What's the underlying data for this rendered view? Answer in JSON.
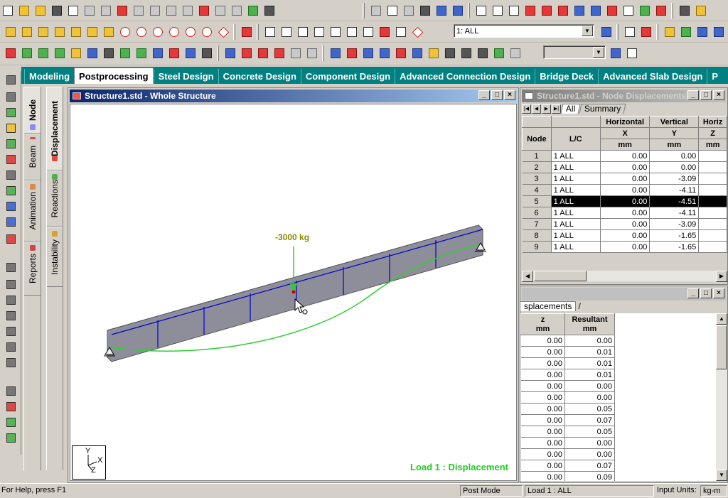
{
  "toolbars": {
    "row2_combo_value": "1: ALL",
    "row3_combo_value": ""
  },
  "page_tabs": [
    {
      "label": "Modeling",
      "active": false
    },
    {
      "label": "Postprocessing",
      "active": true
    },
    {
      "label": "Steel Design",
      "active": false
    },
    {
      "label": "Concrete Design",
      "active": false
    },
    {
      "label": "Component Design",
      "active": false
    },
    {
      "label": "Advanced Connection Design",
      "active": false
    },
    {
      "label": "Bridge Deck",
      "active": false
    },
    {
      "label": "Advanced Slab Design",
      "active": false
    },
    {
      "label": "P",
      "active": false
    }
  ],
  "side_tabs_outer": [
    "Node",
    "Beam",
    "Animation",
    "Reports"
  ],
  "side_tabs_inner": [
    "Displacement",
    "Reactions",
    "Instability"
  ],
  "view_window": {
    "title": "Structure1.std - Whole Structure",
    "load_label": "-3000 kg",
    "status_label": "Load 1 : Displacement",
    "axis_y": "Y",
    "axis_x": "X",
    "axis_z": "Z"
  },
  "displacements_window": {
    "title": "Structure1.std - Node Displacements:",
    "tabs": [
      "All",
      "Summary"
    ],
    "group_headers": [
      "Horizontal",
      "Vertical",
      "Horiz"
    ],
    "col_node": "Node",
    "col_lc": "L/C",
    "col_x": "X",
    "col_y": "Y",
    "col_z": "Z",
    "unit": "mm",
    "rows": [
      {
        "node": "1",
        "lc": "1 ALL",
        "x": "0.00",
        "y": "0.00"
      },
      {
        "node": "2",
        "lc": "1 ALL",
        "x": "0.00",
        "y": "0.00"
      },
      {
        "node": "3",
        "lc": "1 ALL",
        "x": "0.00",
        "y": "-3.09"
      },
      {
        "node": "4",
        "lc": "1 ALL",
        "x": "0.00",
        "y": "-4.11"
      },
      {
        "node": "5",
        "lc": "1 ALL",
        "x": "0.00",
        "y": "-4.51",
        "selected": true
      },
      {
        "node": "6",
        "lc": "1 ALL",
        "x": "0.00",
        "y": "-4.11"
      },
      {
        "node": "7",
        "lc": "1 ALL",
        "x": "0.00",
        "y": "-3.09"
      },
      {
        "node": "8",
        "lc": "1 ALL",
        "x": "0.00",
        "y": "-1.65"
      },
      {
        "node": "9",
        "lc": "1 ALL",
        "x": "0.00",
        "y": "-1.65"
      }
    ]
  },
  "second_window": {
    "tab_label": "splacements",
    "col_z": "z",
    "col_resultant": "Resultant",
    "unit": "mm",
    "rows": [
      {
        "z": "0.00",
        "r": "0.00"
      },
      {
        "z": "0.00",
        "r": "0.01"
      },
      {
        "z": "0.00",
        "r": "0.01"
      },
      {
        "z": "0.00",
        "r": "0.01"
      },
      {
        "z": "0.00",
        "r": "0.00"
      },
      {
        "z": "0.00",
        "r": "0.00"
      },
      {
        "z": "0.00",
        "r": "0.05"
      },
      {
        "z": "0.00",
        "r": "0.07"
      },
      {
        "z": "0.00",
        "r": "0.05"
      },
      {
        "z": "0.00",
        "r": "0.00"
      },
      {
        "z": "0.00",
        "r": "0.00"
      },
      {
        "z": "0.00",
        "r": "0.07"
      },
      {
        "z": "0.00",
        "r": "0.09"
      }
    ]
  },
  "statusbar": {
    "help": "For Help, press F1",
    "mode": "Post Mode",
    "load": "Load 1 : ALL",
    "units_label": "Input Units:",
    "units_value": "kg-m"
  },
  "colors": {
    "title_active": "#0a246a",
    "page_bar": "#008080",
    "beam_fill": "#8e8e9a",
    "mesh_line": "#0000cc",
    "deflection": "#33cc33",
    "load_label": "#8a8a00",
    "status_label": "#22cc22"
  },
  "window_buttons": {
    "minimize": "_",
    "maximize": "□",
    "close": "×"
  }
}
